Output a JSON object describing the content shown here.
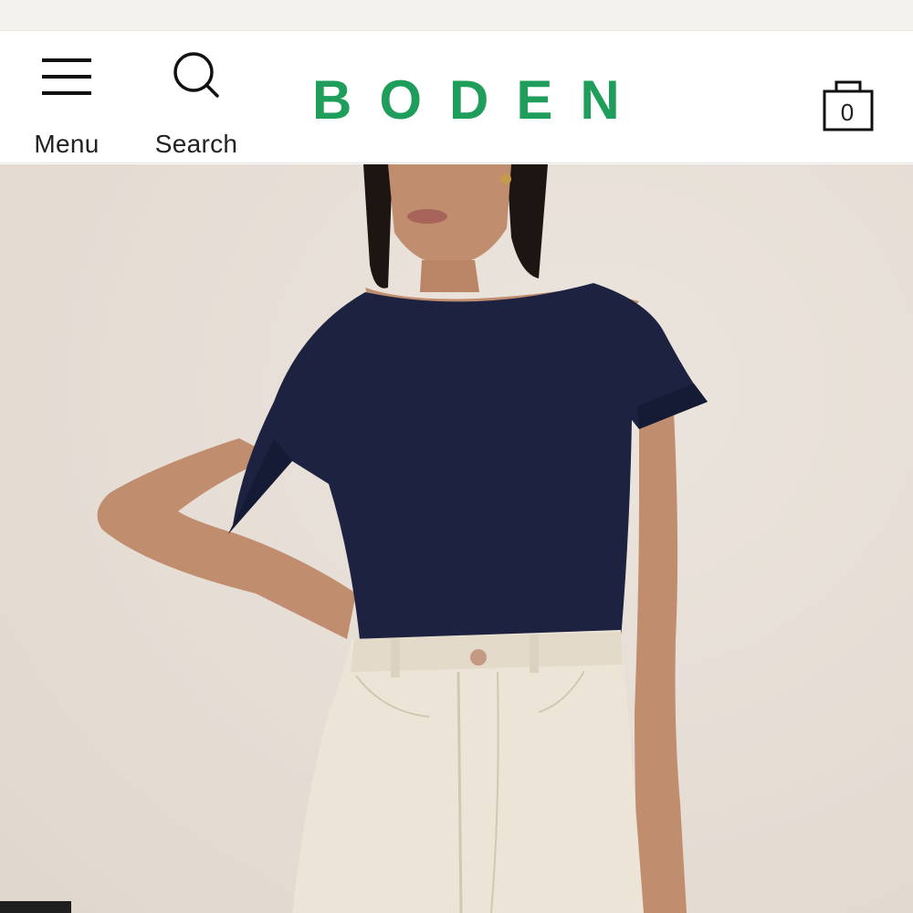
{
  "brand": {
    "logo_text": "BODEN",
    "accent_color": "#1e9e5a"
  },
  "header": {
    "menu": {
      "label": "Menu",
      "icon": "hamburger-menu-icon"
    },
    "search": {
      "label": "Search",
      "icon": "search-icon"
    },
    "bag": {
      "count": "0",
      "icon": "shopping-bag-icon"
    }
  },
  "product_image": {
    "alt": "Navy boat-neck short sleeve top with cream high-waisted jeans"
  }
}
